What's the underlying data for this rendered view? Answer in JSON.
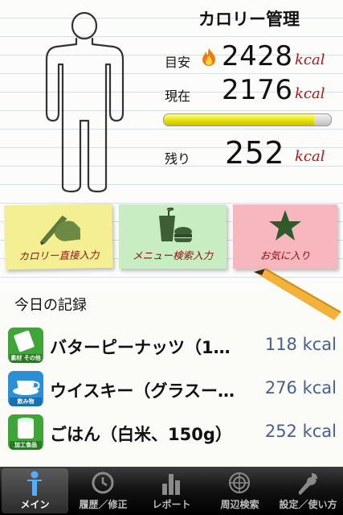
{
  "header": {
    "title": "カロリー管理"
  },
  "stats": {
    "target_label": "目安",
    "target_value": "2428",
    "current_label": "現在",
    "current_value": "2176",
    "remaining_label": "残り",
    "remaining_value": "252",
    "unit": "kcal",
    "progress_fraction": 0.9
  },
  "actions": {
    "direct_input": "カロリー直接入力",
    "menu_search": "メニュー検索入力",
    "favorites": "お気に入り"
  },
  "records": {
    "heading": "今日の記録",
    "items": [
      {
        "name": "バターピーナッツ（1…",
        "calories": "118 kcal",
        "category": "素材 その他"
      },
      {
        "name": "ウイスキー（グラスー…",
        "calories": "276 kcal",
        "category": "飲み物"
      },
      {
        "name": "ごはん（白米、150g）",
        "calories": "252 kcal",
        "category": "加工食品"
      }
    ]
  },
  "tabs": [
    {
      "label": "メイン",
      "icon": "person-icon"
    },
    {
      "label": "履歴／修正",
      "icon": "clock-icon"
    },
    {
      "label": "レポート",
      "icon": "bar-chart-icon"
    },
    {
      "label": "周辺検索",
      "icon": "radar-icon"
    },
    {
      "label": "設定／使い方",
      "icon": "wrench-icon"
    }
  ],
  "colors": {
    "unit": "#b01818",
    "calorie_text": "#4a5f8a",
    "progress": "#e8e000"
  }
}
